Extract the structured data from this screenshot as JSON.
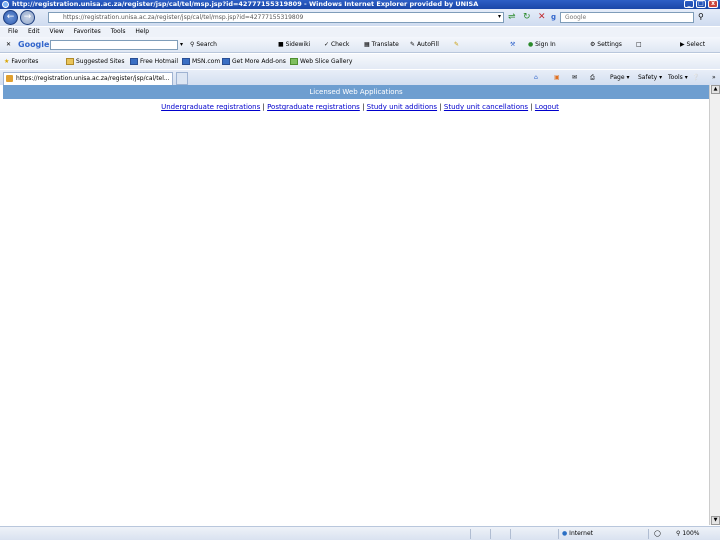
{
  "window": {
    "title": "http://registration.unisa.ac.za/register/jsp/cal/tel/msp.jsp?id=42777155319809 - Windows Internet Explorer provided by UNISA",
    "min_label": "_",
    "max_label": "□",
    "close_label": "x"
  },
  "address_bar": {
    "url": "https://registration.unisa.ac.za/register/jsp/cal/tel/msp.jsp?id=42777155319809",
    "search_placeholder": "Google"
  },
  "menu": [
    "File",
    "Edit",
    "View",
    "Favorites",
    "Tools",
    "Help"
  ],
  "google_toolbar": {
    "logo": "Google",
    "items": [
      "Search",
      "Sidewiki",
      "Check",
      "Translate",
      "AutoFill"
    ],
    "right_items": [
      "Sign In",
      "Settings",
      "Select"
    ]
  },
  "favorites": {
    "label": "Favorites",
    "items": [
      "Suggested Sites",
      "Free Hotmail",
      "MSN.com",
      "Get More Add-ons",
      "Web Slice Gallery"
    ]
  },
  "tab": {
    "label": "https://registration.unisa.ac.za/register/jsp/cal/tel..."
  },
  "command_bar": [
    "Page",
    "Safety",
    "Tools"
  ],
  "page": {
    "banner": "Licensed Web Applications",
    "links": [
      "Undergraduate registrations",
      "Postgraduate registrations",
      "Study unit additions",
      "Study unit cancellations",
      "Logout"
    ],
    "separator": "|"
  },
  "status": {
    "zone": "Internet",
    "zoom": "100%"
  }
}
